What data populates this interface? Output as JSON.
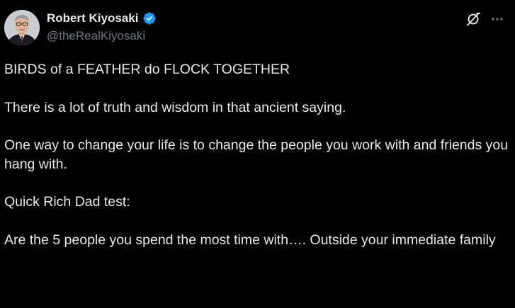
{
  "author": {
    "display_name": "Robert Kiyosaki",
    "handle": "@theRealKiyosaki",
    "verified": true,
    "verified_color": "#1d9bf0"
  },
  "icons": {
    "verified": "verified-badge-icon",
    "grok": "grok-icon",
    "more": "more-options-icon"
  },
  "tweet": {
    "paragraphs": [
      "BIRDS of a FEATHER do FLOCK TOGETHER",
      "There is a lot of truth and wisdom in that ancient saying.",
      "One way to change your life is to change the people you work with and friends you hang with.",
      "Quick Rich Dad test:",
      "Are the 5 people you spend the most time with…. Outside your immediate family"
    ]
  },
  "colors": {
    "background": "#000000",
    "text": "#e7e9ea",
    "secondary": "#71767b"
  }
}
